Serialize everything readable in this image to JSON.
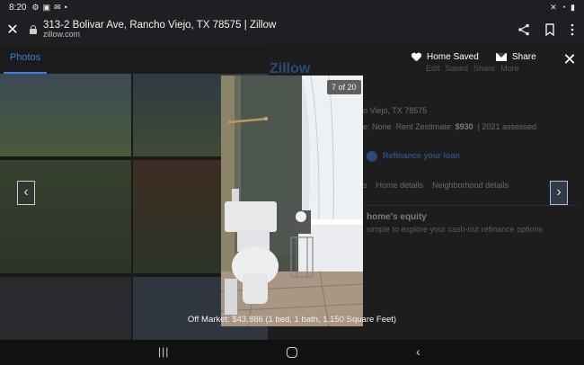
{
  "status_bar": {
    "time": "8:20",
    "left_icons": [
      "settings-icon",
      "image-icon",
      "mail-icon",
      "dot-icon"
    ],
    "right_icons": [
      "mute-icon",
      "wifi-icon",
      "battery-icon"
    ]
  },
  "browser": {
    "title": "313-2 Bolivar Ave, Rancho Viejo, TX 78575 | Zillow",
    "domain": "zillow.com",
    "close_glyph": "✕",
    "share_glyph": "⋖",
    "bookmark_glyph": "⌑",
    "menu_glyph": "⋮"
  },
  "background_page": {
    "tab_photos": "Photos",
    "logo": "Zillow",
    "actions": [
      "Edit",
      "Saved",
      "Share",
      "More"
    ],
    "address_partial": "o Viejo, TX 78575",
    "info_prefix": "e",
    "info_middle": "; None",
    "info_rent_label": "Rent Zestimate",
    "info_rent_value": "$930",
    "info_suffix": "2021 assessed",
    "refinance": "Refinance your loan",
    "nav_items": [
      "s",
      "Home details",
      "Neighborhood details"
    ],
    "equity_title": "home's equity",
    "equity_sub": "simple to explore your cash-out refinance options"
  },
  "overlay": {
    "home_saved_label": "Home Saved",
    "share_label": "Share",
    "close_glyph": "✕",
    "prev_glyph": "‹",
    "next_glyph": "›",
    "counter": "7 of 20",
    "caption": "Off Market: $43,886 (1 bed, 1 bath, 1,150 Square Feet)"
  },
  "navbar": {
    "recent_glyph": "|||",
    "back_glyph": "‹"
  },
  "colors": {
    "accent": "#3e7bd6",
    "bar": "#1e1f22",
    "overlay_bg": "#1a1a1a"
  }
}
